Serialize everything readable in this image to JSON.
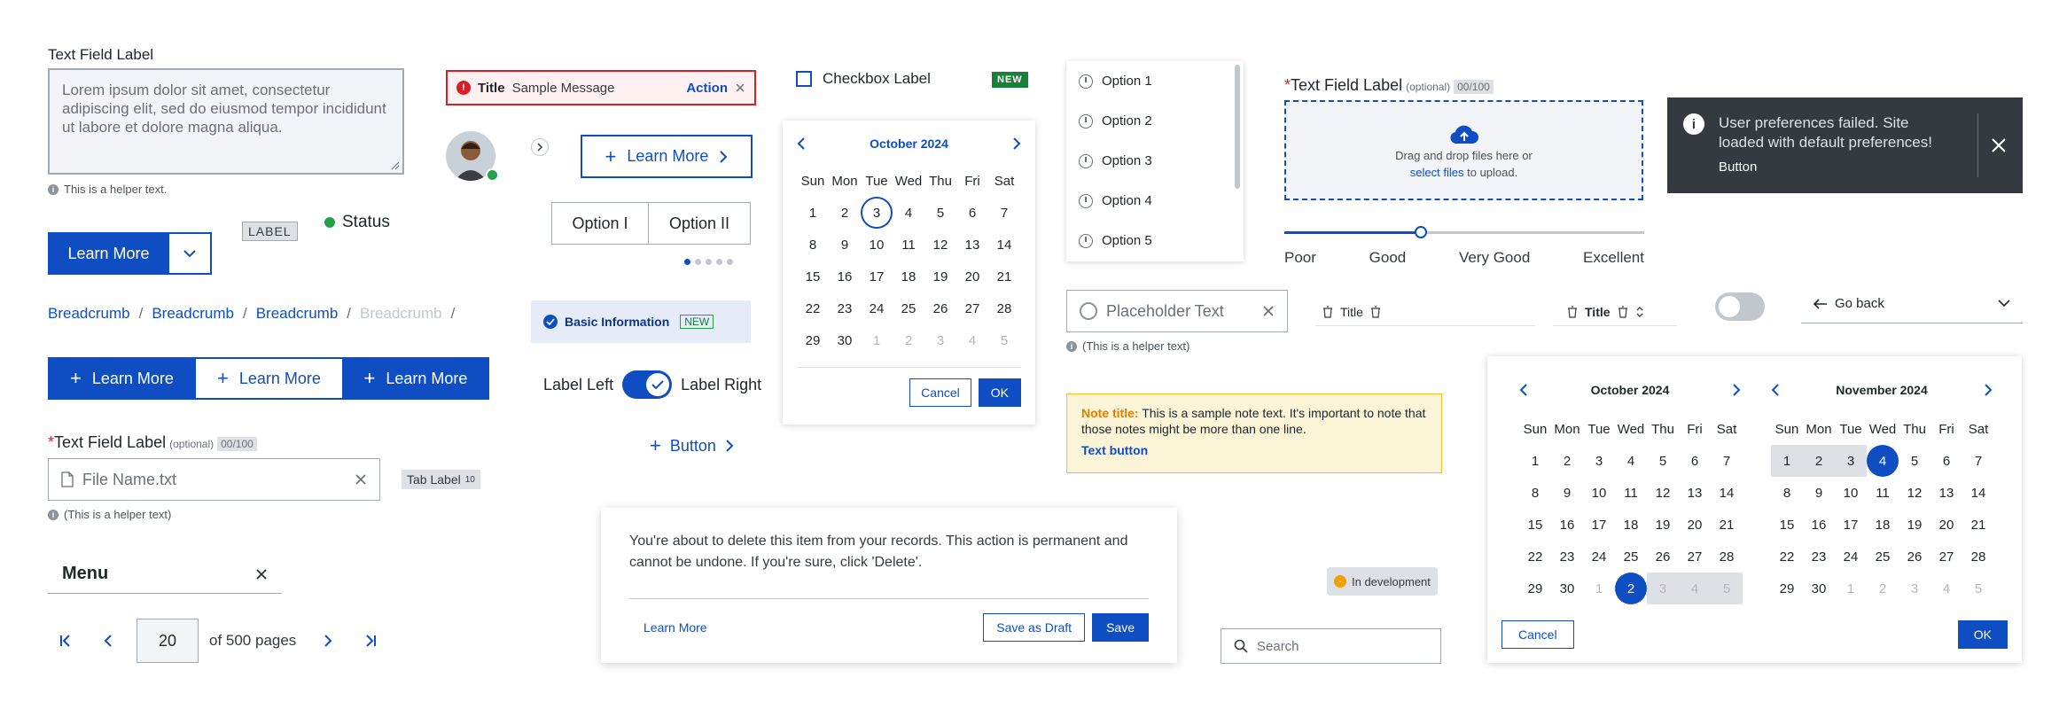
{
  "text_area": {
    "label": "Text Field Label",
    "value": "Lorem ipsum dolor sit amet, consectetur adipiscing elit, sed do eiusmod tempor incididunt ut labore et dolore magna aliqua.",
    "helper": "This is a helper text."
  },
  "split_button": {
    "label": "Learn More"
  },
  "tag": {
    "label": "LABEL"
  },
  "status": {
    "label": "Status",
    "color": "#24a148"
  },
  "breadcrumbs": {
    "items": [
      "Breadcrumb",
      "Breadcrumb",
      "Breadcrumb",
      "Breadcrumb"
    ],
    "separator": "/"
  },
  "button_group": {
    "labels": [
      "Learn More",
      "Learn More",
      "Learn More"
    ]
  },
  "file_field": {
    "label": "Text Field Label",
    "optional": "(optional)",
    "counter": "00/100",
    "value": "File Name.txt",
    "helper": "(This is a helper text)"
  },
  "tab_label": {
    "label": "Tab Label",
    "count": "10"
  },
  "menu": {
    "label": "Menu"
  },
  "pagination": {
    "value": "20",
    "suffix": "of 500 pages"
  },
  "notification": {
    "title": "Title",
    "message": "Sample Message",
    "action": "Action"
  },
  "learn_more_button": {
    "label": "Learn More"
  },
  "segmented": {
    "options": [
      "Option I",
      "Option II"
    ]
  },
  "info_tag": {
    "label": "Basic Information",
    "badge": "NEW"
  },
  "toggle_labels": {
    "left": "Label Left",
    "right": "Label Right"
  },
  "text_button": {
    "label": "Button"
  },
  "checkbox": {
    "label": "Checkbox Label",
    "badge": "NEW"
  },
  "calendar_small": {
    "month": "October 2024",
    "weekdays": [
      "Sun",
      "Mon",
      "Tue",
      "Wed",
      "Thu",
      "Fri",
      "Sat"
    ],
    "days": [
      "1",
      "2",
      "3",
      "4",
      "5",
      "6",
      "7",
      "8",
      "9",
      "10",
      "11",
      "12",
      "13",
      "14",
      "15",
      "16",
      "17",
      "18",
      "19",
      "20",
      "21",
      "22",
      "23",
      "24",
      "25",
      "26",
      "27",
      "28",
      "29",
      "30",
      "1",
      "2",
      "3",
      "4",
      "5"
    ],
    "cancel": "Cancel",
    "ok": "OK"
  },
  "modal": {
    "text": "You're about to delete this item from your records. This action is permanent and cannot be undone. If you're sure, click 'Delete'.",
    "link": "Learn More",
    "draft": "Save as Draft",
    "save": "Save"
  },
  "option_list": {
    "items": [
      "Option 1",
      "Option 2",
      "Option 3",
      "Option 4",
      "Option 5"
    ]
  },
  "radio_field": {
    "placeholder": "Placeholder Text",
    "helper": "(This is a helper text)"
  },
  "sort_headers": {
    "title1": "Title",
    "title2": "Title"
  },
  "note": {
    "title": "Note title:",
    "text": "This is a sample note text. It's important to note that those notes might be more than one line.",
    "button": "Text button"
  },
  "dev_badge": {
    "label": "In development"
  },
  "search": {
    "placeholder": "Search"
  },
  "upload": {
    "label": "Text Field Label",
    "optional": "(optional)",
    "counter": "00/100",
    "text1": "Drag and drop files here or",
    "link": "select files",
    "text2": "to upload."
  },
  "rating_slider": {
    "labels": [
      "Poor",
      "Good",
      "Very Good",
      "Excellent"
    ],
    "value_fraction": 0.38
  },
  "go_back": {
    "label": "Go back"
  },
  "toast": {
    "message": "User preferences failed. Site loaded with default preferences!",
    "button": "Button",
    "bg": "#343a3f"
  },
  "range_calendar": {
    "left_month": "October 2024",
    "right_month": "November 2024",
    "weekdays": [
      "Sun",
      "Mon",
      "Tue",
      "Wed",
      "Thu",
      "Fri",
      "Sat"
    ],
    "left_days": [
      "1",
      "2",
      "3",
      "4",
      "5",
      "6",
      "7",
      "8",
      "9",
      "10",
      "11",
      "12",
      "13",
      "14",
      "15",
      "16",
      "17",
      "18",
      "19",
      "20",
      "21",
      "22",
      "23",
      "24",
      "25",
      "26",
      "27",
      "28",
      "29",
      "30",
      "1",
      "2",
      "3",
      "4",
      "5"
    ],
    "right_days": [
      "1",
      "2",
      "3",
      "4",
      "5",
      "6",
      "7",
      "8",
      "9",
      "10",
      "11",
      "12",
      "13",
      "14",
      "15",
      "16",
      "17",
      "18",
      "19",
      "20",
      "21",
      "22",
      "23",
      "24",
      "25",
      "26",
      "27",
      "28",
      "29",
      "30",
      "1",
      "2",
      "3",
      "4",
      "5"
    ],
    "cancel": "Cancel",
    "ok": "OK"
  },
  "colors": {
    "primary": "#0f4ec2",
    "error": "#da1e28",
    "success": "#24a148"
  }
}
